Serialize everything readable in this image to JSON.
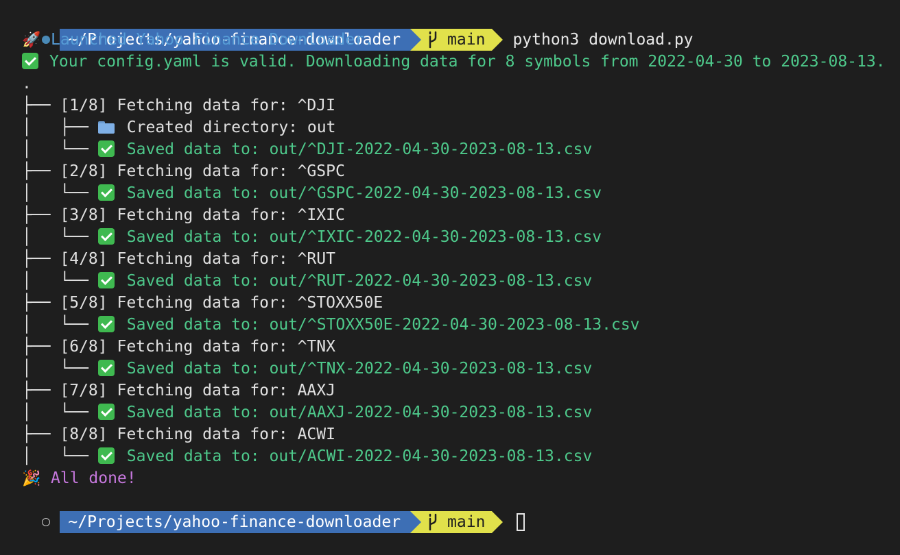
{
  "prompt": {
    "path": "~/Projects/yahoo-finance-downloader",
    "branch": "main",
    "command": "python3 download.py"
  },
  "icons": {
    "top_indicator": "filled-circle-icon",
    "bottom_indicator": "hollow-circle-icon",
    "branch": "git-branch-icon",
    "launch": "rocket-icon",
    "valid": "check-mark-icon",
    "folder": "folder-icon",
    "done": "party-popper-icon"
  },
  "colors": {
    "path_bg": "#3d6fb5",
    "git_bg": "#e1e14b",
    "blue_text": "#569cd6",
    "green_text": "#4ec98b",
    "magenta_text": "#c678dd"
  },
  "output": {
    "launched": "Launched Yahoo Finance Downloader.",
    "valid": "Your config.yaml is valid. Downloading data for 8 symbols from 2022-04-30 to 2023-08-13.",
    "root": ".",
    "created_dir": "Created directory: out",
    "done": "All done!"
  },
  "fetches": [
    {
      "fetch": "[1/8] Fetching data for: ^DJI",
      "saved": "Saved data to: out/^DJI-2022-04-30-2023-08-13.csv"
    },
    {
      "fetch": "[2/8] Fetching data for: ^GSPC",
      "saved": "Saved data to: out/^GSPC-2022-04-30-2023-08-13.csv"
    },
    {
      "fetch": "[3/8] Fetching data for: ^IXIC",
      "saved": "Saved data to: out/^IXIC-2022-04-30-2023-08-13.csv"
    },
    {
      "fetch": "[4/8] Fetching data for: ^RUT",
      "saved": "Saved data to: out/^RUT-2022-04-30-2023-08-13.csv"
    },
    {
      "fetch": "[5/8] Fetching data for: ^STOXX50E",
      "saved": "Saved data to: out/^STOXX50E-2022-04-30-2023-08-13.csv"
    },
    {
      "fetch": "[6/8] Fetching data for: ^TNX",
      "saved": "Saved data to: out/^TNX-2022-04-30-2023-08-13.csv"
    },
    {
      "fetch": "[7/8] Fetching data for: AAXJ",
      "saved": "Saved data to: out/AAXJ-2022-04-30-2023-08-13.csv"
    },
    {
      "fetch": "[8/8] Fetching data for: ACWI",
      "saved": "Saved data to: out/ACWI-2022-04-30-2023-08-13.csv"
    }
  ]
}
